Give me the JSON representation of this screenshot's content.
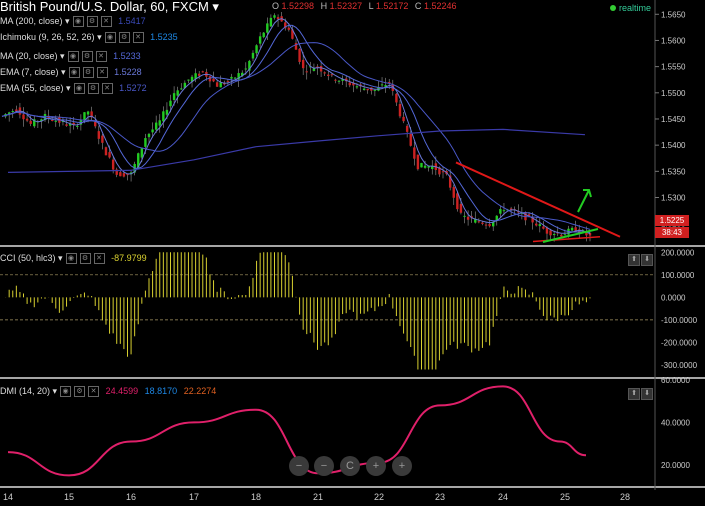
{
  "header": {
    "symbol": "British Pound/U.S. Dollar, 60, FXCM",
    "ohlc": [
      {
        "k": "O",
        "v": "1.52298"
      },
      {
        "k": "H",
        "v": "1.52327"
      },
      {
        "k": "L",
        "v": "1.52172"
      },
      {
        "k": "C",
        "v": "1.52246"
      }
    ],
    "realtime": "realtime"
  },
  "studies": [
    {
      "label": "MA (200, close)",
      "value": "1.5417",
      "color": "#3a4ab8"
    },
    {
      "label": "Ichimoku (9, 26, 52, 26)",
      "value": "1.5235",
      "color": "#1e88e5"
    },
    {
      "label": "MA (20, close)",
      "value": "1.5233",
      "color": "#5468d8"
    },
    {
      "label": "EMA (7, close)",
      "value": "1.5228",
      "color": "#6a78d8"
    },
    {
      "label": "EMA (55, close)",
      "value": "1.5272",
      "color": "#4a58c8"
    }
  ],
  "cci": {
    "label": "CCI (50, hlc3)",
    "value": "-87.9799",
    "color": "#d8d030"
  },
  "dmi": {
    "label": "DMI (14, 20)",
    "values": [
      {
        "v": "24.4599",
        "color": "#e0206a"
      },
      {
        "v": "18.8170",
        "color": "#1e88e5"
      },
      {
        "v": "22.2274",
        "color": "#e06020"
      }
    ]
  },
  "price_axis": [
    "1.5650",
    "1.5600",
    "1.5550",
    "1.5500",
    "1.5450",
    "1.5400",
    "1.5350",
    "1.5300",
    "1.5250"
  ],
  "price_tags": [
    {
      "text": "1.5225",
      "color": "#d02020"
    },
    {
      "text": "38:43",
      "color": "#d02020"
    }
  ],
  "cci_axis": [
    "200.0000",
    "100.0000",
    "0.0000",
    "-100.0000",
    "-200.0000",
    "-300.0000"
  ],
  "dmi_axis": [
    "60.0000",
    "40.0000",
    "20.0000"
  ],
  "x_axis": [
    "14",
    "15",
    "16",
    "17",
    "18",
    "21",
    "22",
    "23",
    "24",
    "25",
    "28"
  ],
  "zoom_buttons": [
    "−",
    "−",
    "C",
    "+",
    "+"
  ],
  "chart_data": [
    {
      "type": "candlestick",
      "title": "British Pound/U.S. Dollar, 60, FXCM",
      "ylim": [
        1.5215,
        1.5662
      ],
      "x_range": [
        "14",
        "28"
      ],
      "close_path": [
        [
          "14",
          1.5455
        ],
        [
          "14",
          1.547
        ],
        [
          "14",
          1.544
        ],
        [
          "15",
          1.5455
        ],
        [
          "15",
          1.5445
        ],
        [
          "15",
          1.5435
        ],
        [
          "15",
          1.5465
        ],
        [
          "15",
          1.54
        ],
        [
          "16",
          1.5345
        ],
        [
          "16",
          1.5345
        ],
        [
          "16",
          1.5415
        ],
        [
          "16",
          1.5445
        ],
        [
          "17",
          1.55
        ],
        [
          "17",
          1.5525
        ],
        [
          "17",
          1.554
        ],
        [
          "17",
          1.5515
        ],
        [
          "18",
          1.5525
        ],
        [
          "18",
          1.5545
        ],
        [
          "18",
          1.5605
        ],
        [
          "18",
          1.565
        ],
        [
          "18",
          1.562
        ],
        [
          "21",
          1.5545
        ],
        [
          "21",
          1.555
        ],
        [
          "21",
          1.553
        ],
        [
          "21",
          1.552
        ],
        [
          "22",
          1.551
        ],
        [
          "22",
          1.5505
        ],
        [
          "22",
          1.552
        ],
        [
          "22",
          1.544
        ],
        [
          "22",
          1.536
        ],
        [
          "23",
          1.536
        ],
        [
          "23",
          1.534
        ],
        [
          "23",
          1.5265
        ],
        [
          "23",
          1.5255
        ],
        [
          "24",
          1.525
        ],
        [
          "24",
          1.528
        ],
        [
          "24",
          1.527
        ],
        [
          "24",
          1.5255
        ],
        [
          "25",
          1.5235
        ],
        [
          "25",
          1.523
        ],
        [
          "25",
          1.524
        ],
        [
          "25",
          1.5225
        ]
      ],
      "ma200_path": [
        [
          "14",
          1.5348
        ],
        [
          "16",
          1.5352
        ],
        [
          "17",
          1.5372
        ],
        [
          "18",
          1.5397
        ],
        [
          "21",
          1.5408
        ],
        [
          "22",
          1.5418
        ],
        [
          "23",
          1.5427
        ],
        [
          "24",
          1.543
        ],
        [
          "25",
          1.542
        ]
      ],
      "annotations": [
        "red descending trendline",
        "red flat support line",
        "green rising line",
        "green up arrow"
      ]
    },
    {
      "type": "bar",
      "title": "CCI (50, hlc3)",
      "ylim": [
        -340,
        210
      ],
      "last": -87.9799,
      "reference_lines": [
        100,
        -100
      ]
    },
    {
      "type": "line",
      "title": "DMI (14, 20)",
      "ylim": [
        10,
        60
      ],
      "series": [
        {
          "name": "DMI",
          "values": [
            [
              "14",
              26
            ],
            [
              "15",
              15
            ],
            [
              "16",
              31
            ],
            [
              "17",
              40
            ],
            [
              "18",
              46
            ],
            [
              "21",
              16
            ],
            [
              "22",
              21
            ],
            [
              "23",
              48
            ],
            [
              "24",
              57
            ],
            [
              "25",
              31
            ],
            [
              "25",
              24.4599
            ]
          ]
        }
      ]
    }
  ]
}
